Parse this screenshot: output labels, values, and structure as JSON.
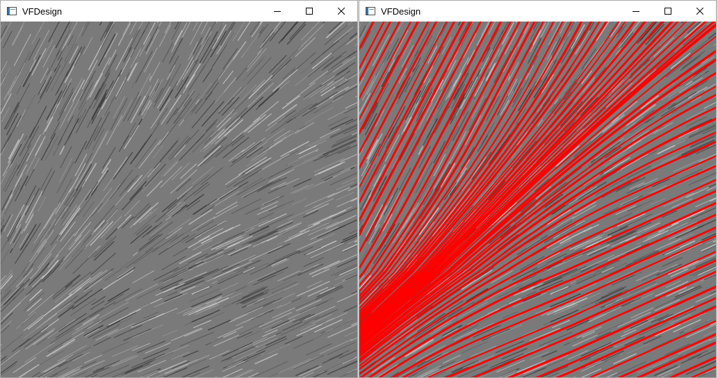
{
  "windows": [
    {
      "title": "VFDesign",
      "overlay_streamlines": false,
      "icons": {
        "app": "app-window-icon",
        "minimize": "minimize-icon",
        "maximize": "maximize-icon",
        "close": "close-icon"
      }
    },
    {
      "title": "VFDesign",
      "overlay_streamlines": true,
      "streamline_color": "#ff0000",
      "icons": {
        "app": "app-window-icon",
        "minimize": "minimize-icon",
        "maximize": "maximize-icon",
        "close": "close-icon"
      }
    }
  ],
  "colors": {
    "lic_background": "#7a7a7a",
    "streamline": "#ff0000",
    "titlebar": "#ffffff"
  }
}
